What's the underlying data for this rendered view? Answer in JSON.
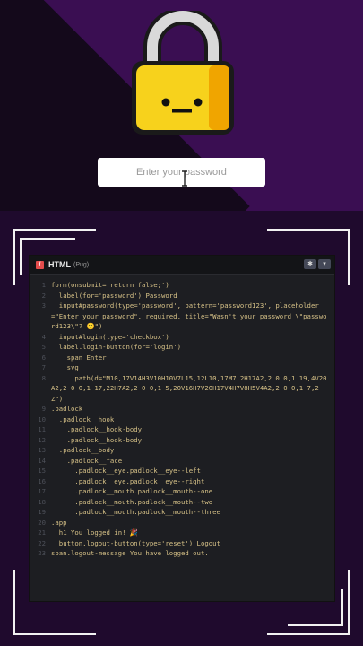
{
  "password_input": {
    "placeholder": "Enter your password",
    "value": ""
  },
  "editor": {
    "tab_label": "HTML",
    "tab_sub": "(Pug)",
    "settings_icon": "gear-icon",
    "collapse_icon": "chevron-down-icon",
    "lines": [
      {
        "n": "1",
        "t": "form(onsubmit='return false;')"
      },
      {
        "n": "2",
        "t": "  label(for='password') Password"
      },
      {
        "n": "3",
        "t": "  input#password(type='password', pattern='password123', placeholder=\"Enter your password\", required, title=\"Wasn't your password \\\"password123\\\"? 🙂\")"
      },
      {
        "n": "4",
        "t": "  input#login(type='checkbox')"
      },
      {
        "n": "5",
        "t": "  label.login-button(for='login')"
      },
      {
        "n": "6",
        "t": "    span Enter"
      },
      {
        "n": "7",
        "t": "    svg"
      },
      {
        "n": "8",
        "t": "      path(d=\"M10,17V14H3V10H10V7L15,12L10,17M7,2H17A2,2 0 0,1 19,4V20A2,2 0 0,1 17,22H7A2,2 0 0,1 5,20V16H7V20H17V4H7V8H5V4A2,2 0 0,1 7,2Z\")"
      },
      {
        "n": "9",
        "t": ".padlock"
      },
      {
        "n": "10",
        "t": "  .padlock__hook"
      },
      {
        "n": "11",
        "t": "    .padlock__hook-body"
      },
      {
        "n": "12",
        "t": "    .padlock__hook-body"
      },
      {
        "n": "13",
        "t": "  .padlock__body"
      },
      {
        "n": "14",
        "t": "    .padlock__face"
      },
      {
        "n": "15",
        "t": "      .padlock__eye.padlock__eye--left"
      },
      {
        "n": "16",
        "t": "      .padlock__eye.padlock__eye--right"
      },
      {
        "n": "17",
        "t": "      .padlock__mouth.padlock__mouth--one"
      },
      {
        "n": "18",
        "t": "      .padlock__mouth.padlock__mouth--two"
      },
      {
        "n": "19",
        "t": "      .padlock__mouth.padlock__mouth--three"
      },
      {
        "n": "20",
        "t": ".app"
      },
      {
        "n": "21",
        "t": "  h1 You logged in! 🎉"
      },
      {
        "n": "22",
        "t": "  button.logout-button(type='reset') Logout"
      },
      {
        "n": "23",
        "t": "span.logout-message You have logged out."
      }
    ]
  },
  "colors": {
    "background_top": "#3a0e52",
    "background_bottom": "#1f0a2d",
    "lock_body": "#f7d21c",
    "lock_shade": "#f0a500",
    "lock_hook": "#dcdcdc"
  }
}
